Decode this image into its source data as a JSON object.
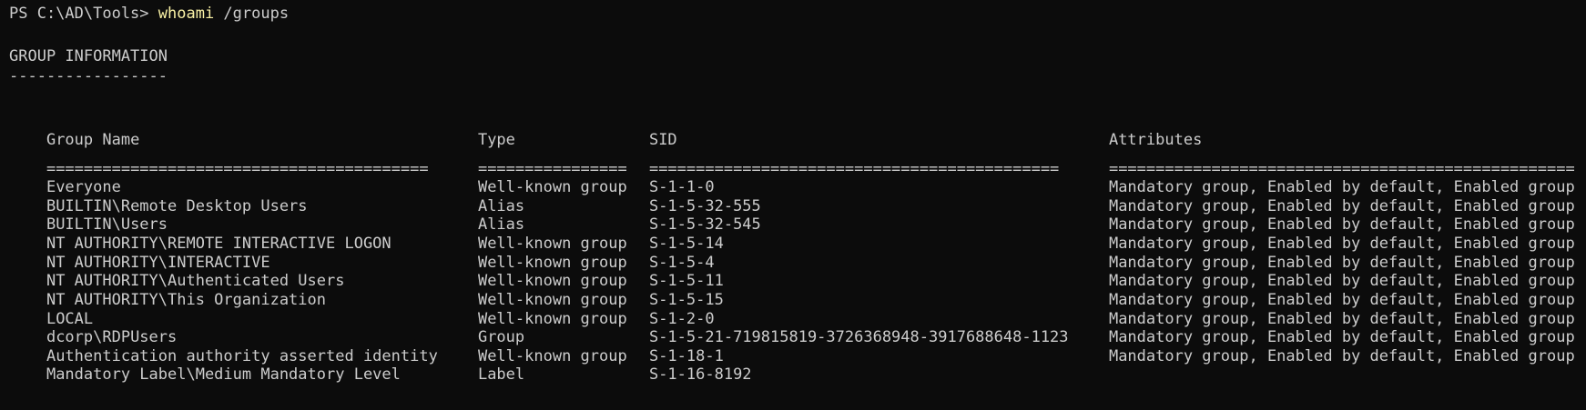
{
  "prompt": {
    "text": "PS C:\\AD\\Tools> ",
    "command": "whoami",
    "args": " /groups"
  },
  "section_title": "GROUP INFORMATION",
  "section_underline": "-----------------",
  "table": {
    "headers": [
      "Group Name",
      "Type",
      "SID",
      "Attributes"
    ],
    "separators": [
      "=========================================",
      "================",
      "============================================",
      "=================================================="
    ],
    "rows": [
      [
        "Everyone",
        "Well-known group",
        "S-1-1-0",
        "Mandatory group, Enabled by default, Enabled group"
      ],
      [
        "BUILTIN\\Remote Desktop Users",
        "Alias",
        "S-1-5-32-555",
        "Mandatory group, Enabled by default, Enabled group"
      ],
      [
        "BUILTIN\\Users",
        "Alias",
        "S-1-5-32-545",
        "Mandatory group, Enabled by default, Enabled group"
      ],
      [
        "NT AUTHORITY\\REMOTE INTERACTIVE LOGON",
        "Well-known group",
        "S-1-5-14",
        "Mandatory group, Enabled by default, Enabled group"
      ],
      [
        "NT AUTHORITY\\INTERACTIVE",
        "Well-known group",
        "S-1-5-4",
        "Mandatory group, Enabled by default, Enabled group"
      ],
      [
        "NT AUTHORITY\\Authenticated Users",
        "Well-known group",
        "S-1-5-11",
        "Mandatory group, Enabled by default, Enabled group"
      ],
      [
        "NT AUTHORITY\\This Organization",
        "Well-known group",
        "S-1-5-15",
        "Mandatory group, Enabled by default, Enabled group"
      ],
      [
        "LOCAL",
        "Well-known group",
        "S-1-2-0",
        "Mandatory group, Enabled by default, Enabled group"
      ],
      [
        "dcorp\\RDPUsers",
        "Group",
        "S-1-5-21-719815819-3726368948-3917688648-1123",
        "Mandatory group, Enabled by default, Enabled group"
      ],
      [
        "Authentication authority asserted identity",
        "Well-known group",
        "S-1-18-1",
        "Mandatory group, Enabled by default, Enabled group"
      ],
      [
        "Mandatory Label\\Medium Mandatory Level",
        "Label",
        "S-1-16-8192",
        ""
      ]
    ]
  },
  "colors": {
    "background": "#0c0c0c",
    "text": "#cccccc",
    "command": "#f9f1a5"
  }
}
